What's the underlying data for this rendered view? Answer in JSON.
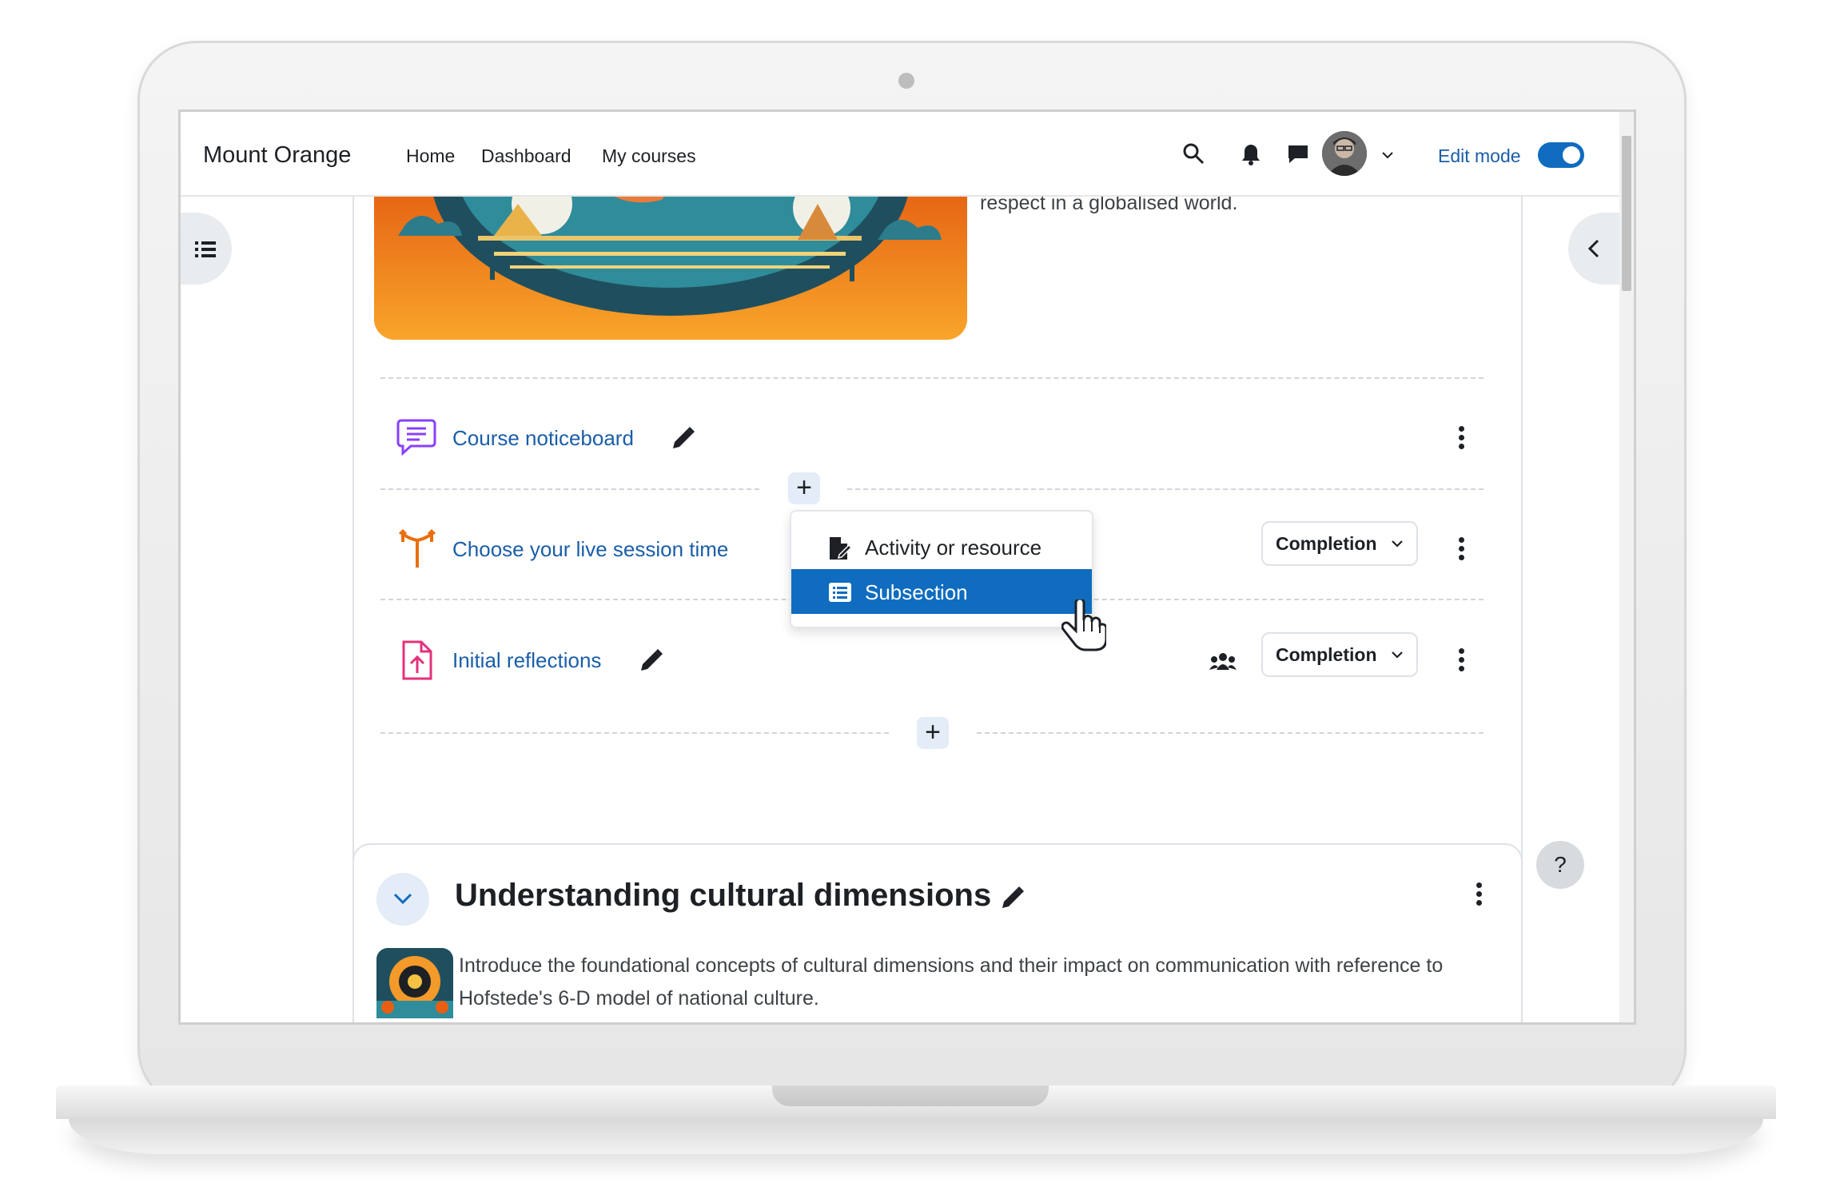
{
  "navbar": {
    "brand": "Mount Orange",
    "links": [
      "Home",
      "Dashboard",
      "My courses"
    ],
    "edit_mode_label": "Edit mode",
    "edit_mode_on": true
  },
  "section1": {
    "hero_text": "respect in a globalised world.",
    "activities": [
      {
        "title": "Course noticeboard",
        "icon": "forum-icon",
        "has_edit": true,
        "completion": null
      },
      {
        "title": "Choose your live session time",
        "icon": "choice-icon",
        "has_edit": false,
        "completion": "Completion"
      },
      {
        "title": "Initial reflections",
        "icon": "assignment-icon",
        "has_edit": true,
        "completion": "Completion",
        "group_icon": "group-icon"
      }
    ],
    "add_menu": {
      "items": [
        {
          "label": "Activity or resource",
          "icon": "activity-resource-icon",
          "selected": false
        },
        {
          "label": "Subsection",
          "icon": "subsection-icon",
          "selected": true
        }
      ]
    },
    "add_symbol": "+"
  },
  "section2": {
    "title": "Understanding cultural dimensions",
    "description": "Introduce the foundational concepts of cultural dimensions and their impact on communication with reference to Hofstede's 6-D model of national culture."
  },
  "help_label": "?",
  "colors": {
    "primary": "#0f6cbf",
    "link": "#1a5ea8",
    "forum_icon": "#8a3ffc",
    "choice_icon": "#ea6e0e",
    "assign_icon": "#e3317a"
  }
}
